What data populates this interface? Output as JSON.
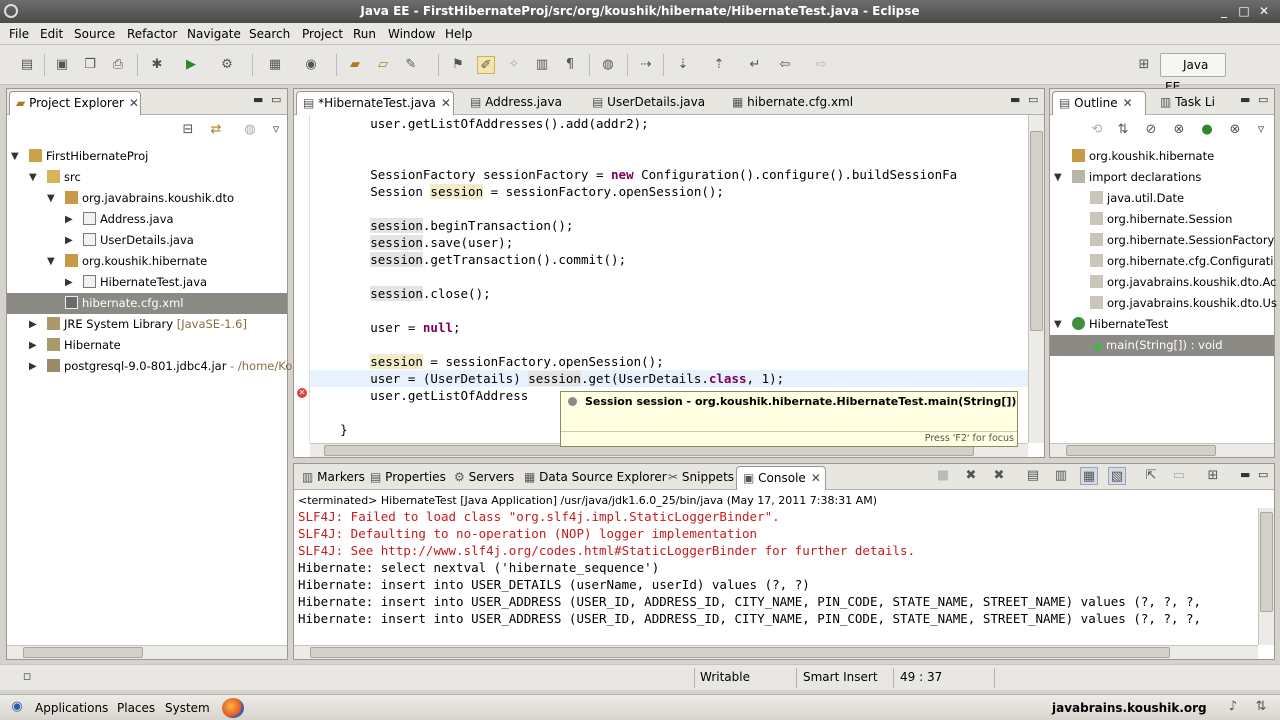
{
  "window": {
    "title": "Java EE - FirstHibernateProj/src/org/koushik/hibernate/HibernateTest.java - Eclipse",
    "min": "_",
    "max": "□",
    "close": "✕"
  },
  "menu": [
    "File",
    "Edit",
    "Source",
    "Refactor",
    "Navigate",
    "Search",
    "Project",
    "Run",
    "Window",
    "Help"
  ],
  "perspective": "Java EE",
  "project_explorer": {
    "tab": "Project Explorer",
    "items": [
      {
        "label": "FirstHibernateProj",
        "extra": ""
      },
      {
        "label": "src",
        "extra": ""
      },
      {
        "label": "org.javabrains.koushik.dto",
        "extra": ""
      },
      {
        "label": "Address.java",
        "extra": ""
      },
      {
        "label": "UserDetails.java",
        "extra": ""
      },
      {
        "label": "org.koushik.hibernate",
        "extra": ""
      },
      {
        "label": "HibernateTest.java",
        "extra": ""
      },
      {
        "label": "hibernate.cfg.xml",
        "extra": ""
      },
      {
        "label": "JRE System Library",
        "extra": "[JavaSE-1.6]"
      },
      {
        "label": "Hibernate",
        "extra": ""
      },
      {
        "label": "postgresql-9.0-801.jdbc4.jar",
        "extra": "- /home/Kou"
      }
    ]
  },
  "editor": {
    "tabs": [
      "*HibernateTest.java",
      "Address.java",
      "UserDetails.java",
      "hibernate.cfg.xml"
    ],
    "lines": [
      {
        "pre": "        user.getListOfAddresses().add(addr2);",
        "kw": "",
        "post": ""
      },
      {
        "pre": "",
        "kw": "",
        "post": ""
      },
      {
        "pre": "",
        "kw": "",
        "post": ""
      },
      {
        "pre": "        SessionFactory sessionFactory = ",
        "kw": "new",
        "post": " Configuration().configure().buildSessionFa"
      },
      {
        "pre": "        Session ",
        "hl": "session",
        "post": " = sessionFactory.openSession();"
      },
      {
        "pre": "",
        "kw": "",
        "post": ""
      },
      {
        "pre": "        ",
        "hlg": "session",
        "post": ".beginTransaction();"
      },
      {
        "pre": "        ",
        "hlg": "session",
        "post": ".save(user);"
      },
      {
        "pre": "        ",
        "hlg": "session",
        "post": ".getTransaction().commit();"
      },
      {
        "pre": "",
        "kw": "",
        "post": ""
      },
      {
        "pre": "        ",
        "hlg": "session",
        "post": ".close();"
      },
      {
        "pre": "",
        "kw": "",
        "post": ""
      },
      {
        "pre": "        user = ",
        "kw": "null",
        "post": ";"
      },
      {
        "pre": "",
        "kw": "",
        "post": ""
      },
      {
        "pre": "        ",
        "hl": "session",
        "post": " = sessionFactory.openSession();"
      },
      {
        "pre": "        user = (UserDetails) ",
        "hlg": "session",
        "post": ".get(UserDetails.",
        "kw2": "class",
        "post2": ", 1);"
      },
      {
        "pre": "        user.getListOfAddress",
        "kw": "",
        "post": ""
      },
      {
        "pre": "",
        "kw": "",
        "post": ""
      },
      {
        "pre": "    }",
        "kw": "",
        "post": ""
      }
    ]
  },
  "tooltip": {
    "title": "Session session - org.koushik.hibernate.HibernateTest.main(String[])",
    "footer": "Press 'F2' for focus"
  },
  "outline": {
    "tabs": [
      "Outline",
      "Task Li"
    ],
    "items": [
      "org.koushik.hibernate",
      "import declarations",
      "java.util.Date",
      "org.hibernate.Session",
      "org.hibernate.SessionFactory",
      "org.hibernate.cfg.Configurati",
      "org.javabrains.koushik.dto.Ac",
      "org.javabrains.koushik.dto.Us",
      "HibernateTest",
      "main(String[]) : void"
    ]
  },
  "bottom": {
    "tabs": [
      "Markers",
      "Properties",
      "Servers",
      "Data Source Explorer",
      "Snippets",
      "Console"
    ],
    "info": "<terminated> HibernateTest [Java Application] /usr/java/jdk1.6.0_25/bin/java (May 17, 2011 7:38:31 AM)",
    "lines": [
      {
        "text": "SLF4J: Failed to load class \"org.slf4j.impl.StaticLoggerBinder\".",
        "err": true
      },
      {
        "text": "SLF4J: Defaulting to no-operation (NOP) logger implementation",
        "err": true
      },
      {
        "text": "SLF4J: See http://www.slf4j.org/codes.html#StaticLoggerBinder for further details.",
        "err": true
      },
      {
        "text": "Hibernate: select nextval ('hibernate_sequence')",
        "err": false
      },
      {
        "text": "Hibernate: insert into USER_DETAILS (userName, userId) values (?, ?)",
        "err": false
      },
      {
        "text": "Hibernate: insert into USER_ADDRESS (USER_ID, ADDRESS_ID, CITY_NAME, PIN_CODE, STATE_NAME, STREET_NAME) values (?, ?, ?,",
        "err": false
      },
      {
        "text": "Hibernate: insert into USER_ADDRESS (USER_ID, ADDRESS_ID, CITY_NAME, PIN_CODE, STATE_NAME, STREET_NAME) values (?, ?, ?,",
        "err": false
      }
    ]
  },
  "status": {
    "writable": "Writable",
    "insert": "Smart Insert",
    "position": "49 : 37"
  },
  "taskbar": {
    "applications": "Applications",
    "places": "Places",
    "system": "System",
    "site": "javabrains.koushik.org"
  }
}
